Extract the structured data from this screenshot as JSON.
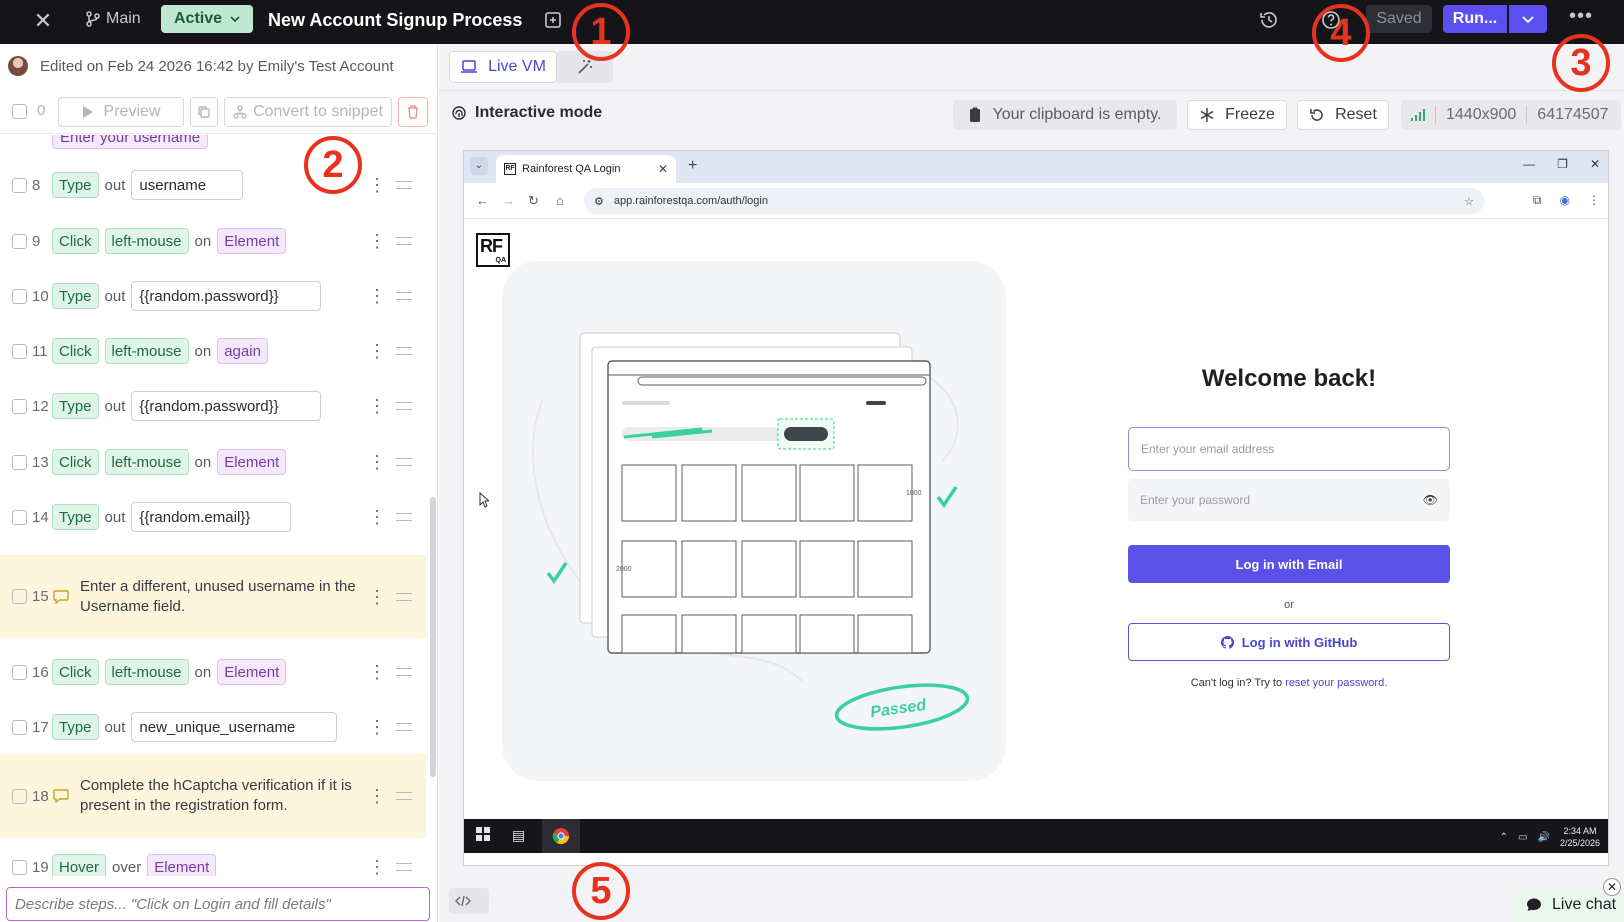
{
  "topbar": {
    "branch_label": "Main",
    "status_label": "Active",
    "title": "New Account Signup Process",
    "saved_label": "Saved",
    "run_label": "Run..."
  },
  "left": {
    "edited_text": "Edited on Feb 24 2026 16:42 by Emily's Test Account",
    "selected_count": "0",
    "preview_label": "Preview",
    "snippet_label": "Convert to snippet",
    "partial_step_text": "Enter your username",
    "describe_placeholder": "Describe steps... \"Click on Login and fill details\""
  },
  "steps": [
    {
      "num": "8",
      "verb": "Type",
      "word": "out",
      "value": "username"
    },
    {
      "num": "9",
      "verb": "Click",
      "button": "left-mouse",
      "word": "on",
      "target": "Element"
    },
    {
      "num": "10",
      "verb": "Type",
      "word": "out",
      "value": "{{random.password}}"
    },
    {
      "num": "11",
      "verb": "Click",
      "button": "left-mouse",
      "word": "on",
      "target": "again"
    },
    {
      "num": "12",
      "verb": "Type",
      "word": "out",
      "value": "{{random.password}}"
    },
    {
      "num": "13",
      "verb": "Click",
      "button": "left-mouse",
      "word": "on",
      "target": "Element"
    },
    {
      "num": "14",
      "verb": "Type",
      "word": "out",
      "value": "{{random.email}}"
    },
    {
      "num": "15",
      "comment": "Enter a different, unused username in the Username field."
    },
    {
      "num": "16",
      "verb": "Click",
      "button": "left-mouse",
      "word": "on",
      "target": "Element"
    },
    {
      "num": "17",
      "verb": "Type",
      "word": "out",
      "value": "new_unique_username"
    },
    {
      "num": "18",
      "comment": "Complete the hCaptcha verification if it is present in the registration form."
    },
    {
      "num": "19",
      "verb": "Hover",
      "word": "over",
      "target": "Element"
    }
  ],
  "right": {
    "tab_livevm": "Live VM",
    "interactive_mode": "Interactive mode",
    "clipboard": "Your clipboard is empty.",
    "freeze": "Freeze",
    "reset": "Reset",
    "resolution": "1440x900",
    "vm_id": "64174507",
    "live_chat": "Live chat"
  },
  "browser": {
    "tab_title": "Rainforest QA Login",
    "url": "app.rainforestqa.com/auth/login",
    "logo_text": "RF",
    "logo_sub": "QA",
    "welcome": "Welcome back!",
    "email_placeholder": "Enter your email address",
    "password_placeholder": "Enter your password",
    "login_email": "Log in with Email",
    "or": "or",
    "login_github": "Log in with GitHub",
    "cant_login": "Can't log in? Try to ",
    "reset_link": "reset your password.",
    "illus_passed": "Passed",
    "illus_num_1000": "1000",
    "illus_num_2000": "2000",
    "clock_time": "2:34 AM",
    "clock_date": "2/25/2026"
  },
  "annotations": [
    "1",
    "2",
    "3",
    "4",
    "5"
  ],
  "colors": {
    "accent": "#5b4ff0",
    "active_green": "#bfe8d2",
    "annotation_red": "#e8321e",
    "comment_bg": "#fdf6dd"
  }
}
